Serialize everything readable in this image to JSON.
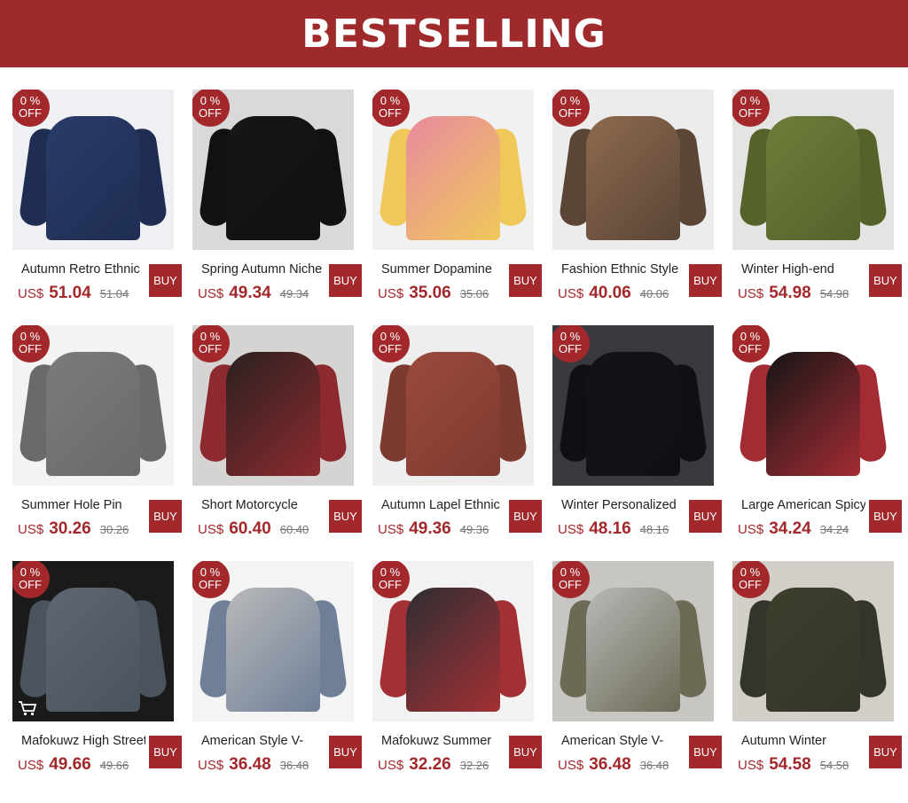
{
  "banner": {
    "title": "BESTSELLING"
  },
  "colors": {
    "accent": "#a3282b",
    "banner": "#9e2a2b"
  },
  "products": [
    {
      "title": "Autumn Retro Ethnic",
      "currency": "US$",
      "price": "51.04",
      "old_price": "51.04",
      "discount_line1": "0 %",
      "discount_line2": "OFF",
      "buy": "BUY",
      "palette": [
        "#eef0f3",
        "#2a3c68",
        "#1f2d52"
      ]
    },
    {
      "title": "Spring Autumn Niche",
      "currency": "US$",
      "price": "49.34",
      "old_price": "49.34",
      "discount_line1": "0 %",
      "discount_line2": "OFF",
      "buy": "BUY",
      "palette": [
        "#d9d9dc",
        "#161616",
        "#111111"
      ]
    },
    {
      "title": "Summer Dopamine",
      "currency": "US$",
      "price": "35.06",
      "old_price": "35.06",
      "discount_line1": "0 %",
      "discount_line2": "OFF",
      "buy": "BUY",
      "palette": [
        "#f1f1f1",
        "#e88a9f",
        "#f0c85a"
      ]
    },
    {
      "title": "Fashion Ethnic Style",
      "currency": "US$",
      "price": "40.06",
      "old_price": "40.06",
      "discount_line1": "0 %",
      "discount_line2": "OFF",
      "buy": "BUY",
      "palette": [
        "#ececec",
        "#8e6a4f",
        "#5a4536"
      ]
    },
    {
      "title": "Winter High-end",
      "currency": "US$",
      "price": "54.98",
      "old_price": "54.98",
      "discount_line1": "0 %",
      "discount_line2": "OFF",
      "buy": "BUY",
      "palette": [
        "#e4e4e2",
        "#6e7d3a",
        "#55632b"
      ]
    },
    {
      "title": "Summer Hole Pin",
      "currency": "US$",
      "price": "30.26",
      "old_price": "30.26",
      "discount_line1": "0 %",
      "discount_line2": "OFF",
      "buy": "BUY",
      "palette": [
        "#f3f3f3",
        "#7b7b7b",
        "#6a6a6a"
      ]
    },
    {
      "title": "Short Motorcycle",
      "currency": "US$",
      "price": "60.40",
      "old_price": "60.40",
      "discount_line1": "0 %",
      "discount_line2": "OFF",
      "buy": "BUY",
      "palette": [
        "#d6d4d2",
        "#2b2020",
        "#8c2a2f"
      ]
    },
    {
      "title": "Autumn Lapel Ethnic",
      "currency": "US$",
      "price": "49.36",
      "old_price": "49.36",
      "discount_line1": "0 %",
      "discount_line2": "OFF",
      "buy": "BUY",
      "palette": [
        "#eeeeee",
        "#9c4a3c",
        "#7d3a30"
      ]
    },
    {
      "title": "Winter Personalized",
      "currency": "US$",
      "price": "48.16",
      "old_price": "48.16",
      "discount_line1": "0 %",
      "discount_line2": "OFF",
      "buy": "BUY",
      "palette": [
        "#3a3a3e",
        "#121318",
        "#0f1014"
      ]
    },
    {
      "title": "Large American Spicy",
      "currency": "US$",
      "price": "34.24",
      "old_price": "34.24",
      "discount_line1": "0 %",
      "discount_line2": "OFF",
      "buy": "BUY",
      "palette": [
        "#ffffff",
        "#151515",
        "#a32c34"
      ]
    },
    {
      "title": "Mafokuwz High Street",
      "currency": "US$",
      "price": "49.66",
      "old_price": "49.66",
      "discount_line1": "0 %",
      "discount_line2": "OFF",
      "buy": "BUY",
      "palette": [
        "#1a1a1a",
        "#5d6672",
        "#4b535c"
      ]
    },
    {
      "title": "American Style V-",
      "currency": "US$",
      "price": "36.48",
      "old_price": "36.48",
      "discount_line1": "0 %",
      "discount_line2": "OFF",
      "buy": "BUY",
      "palette": [
        "#f4f4f4",
        "#b9b9b9",
        "#6f7f98"
      ]
    },
    {
      "title": "Mafokuwz Summer",
      "currency": "US$",
      "price": "32.26",
      "old_price": "32.26",
      "discount_line1": "0 %",
      "discount_line2": "OFF",
      "buy": "BUY",
      "palette": [
        "#f2f2f2",
        "#2e2e33",
        "#a33034"
      ]
    },
    {
      "title": "American Style V-",
      "currency": "US$",
      "price": "36.48",
      "old_price": "36.48",
      "discount_line1": "0 %",
      "discount_line2": "OFF",
      "buy": "BUY",
      "palette": [
        "#c8c6c2",
        "#b8b8b8",
        "#6b6a55"
      ]
    },
    {
      "title": "Autumn Winter",
      "currency": "US$",
      "price": "54.58",
      "old_price": "54.58",
      "discount_line1": "0 %",
      "discount_line2": "OFF",
      "buy": "BUY",
      "palette": [
        "#d2cfc8",
        "#3e3f2c",
        "#34352a"
      ]
    }
  ],
  "icons": {
    "badge": "discount-badge",
    "cart": "cart-icon"
  }
}
